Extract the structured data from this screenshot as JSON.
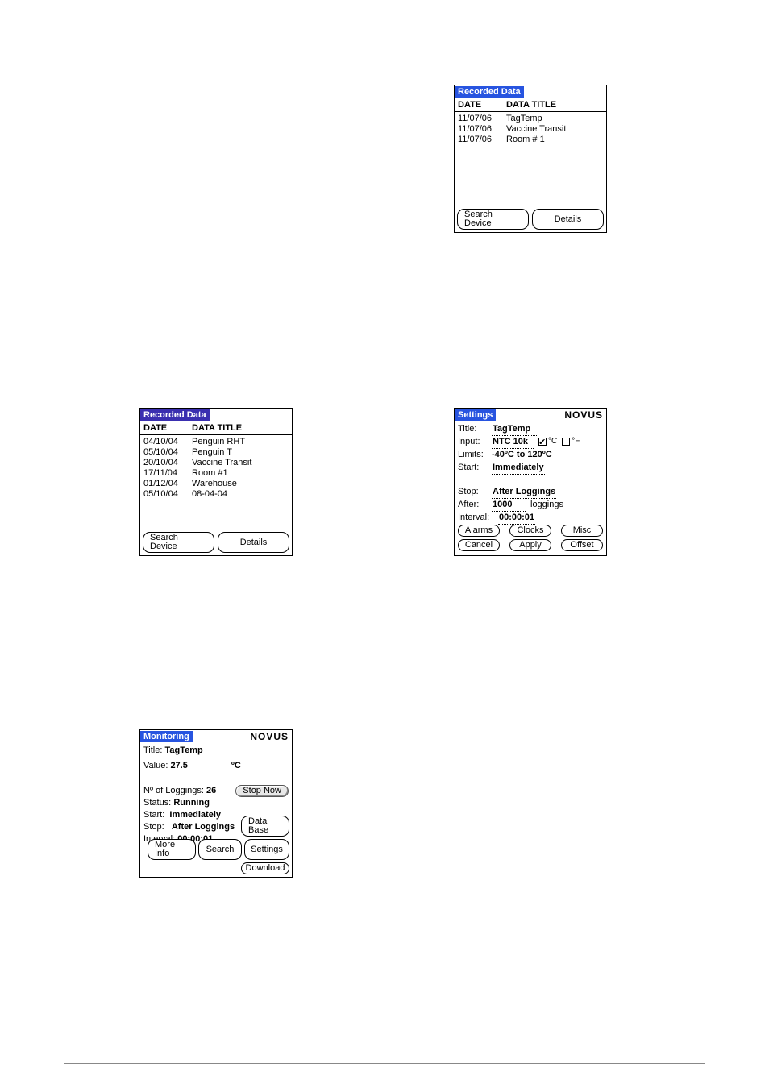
{
  "win1": {
    "title": "Recorded Data",
    "col_date": "DATE",
    "col_title": "DATA TITLE",
    "rows": [
      {
        "date": "11/07/06",
        "title": "TagTemp"
      },
      {
        "date": "11/07/06",
        "title": "Vaccine Transit"
      },
      {
        "date": "11/07/06",
        "title": "Room # 1"
      }
    ],
    "btn_search": "Search Device",
    "btn_details": "Details"
  },
  "win2": {
    "title": "Recorded Data",
    "col_date": "DATE",
    "col_title": "DATA TITLE",
    "rows": [
      {
        "date": "04/10/04",
        "title": "Penguin RHT"
      },
      {
        "date": "05/10/04",
        "title": "Penguin T"
      },
      {
        "date": "20/10/04",
        "title": "Vaccine Transit"
      },
      {
        "date": "17/11/04",
        "title": "Room #1"
      },
      {
        "date": "01/12/04",
        "title": "Warehouse"
      },
      {
        "date": "05/10/04",
        "title": "08-04-04"
      }
    ],
    "btn_search": "Search Device",
    "btn_details": "Details"
  },
  "win3": {
    "title": "Settings",
    "brand": "NOVUS",
    "lbl_title": "Title:",
    "val_title": "TagTemp",
    "lbl_input": "Input:",
    "val_input": "NTC 10k",
    "unit_c": "°C",
    "unit_f": "°F",
    "cb_c_checked": true,
    "cb_f_checked": false,
    "lbl_limits": "Limits:",
    "val_limits": "-40ºC to 120ºC",
    "lbl_start": "Start:",
    "val_start": "Immediately",
    "lbl_stop": "Stop:",
    "val_stop": "After Loggings",
    "lbl_after": "After:",
    "val_after": "1000",
    "lbl_after_suffix": "loggings",
    "lbl_interval": "Interval:",
    "val_interval": "00:00:01",
    "btn_alarms": "Alarms",
    "btn_clocks": "Clocks",
    "btn_misc": "Misc",
    "btn_cancel": "Cancel",
    "btn_apply": "Apply",
    "btn_offset": "Offset"
  },
  "win4": {
    "title": "Monitoring",
    "brand": "NOVUS",
    "lbl_title": "Title:",
    "val_title": "TagTemp",
    "lbl_value": "Value:",
    "val_value": "27.5",
    "val_unit": "ºC",
    "lbl_nlogs": "Nº of Loggings:",
    "val_nlogs": "26",
    "btn_stop": "Stop Now",
    "lbl_status": "Status:",
    "val_status": "Running",
    "lbl_start": "Start:",
    "val_start": "Immediately",
    "lbl_stop": "Stop:",
    "val_stop": "After Loggings",
    "lbl_interval": "Interval:",
    "val_interval": "00:00:01",
    "btn_database": "Data Base",
    "btn_moreinfo": "More Info",
    "btn_search": "Search",
    "btn_settings": "Settings",
    "btn_download": "Download"
  }
}
